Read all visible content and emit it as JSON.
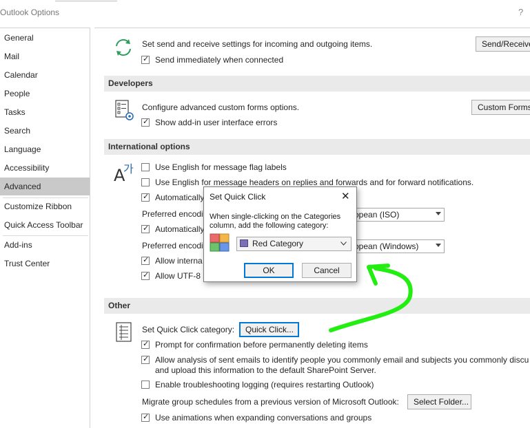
{
  "window": {
    "title": "Outlook Options",
    "help": "?"
  },
  "nav": {
    "items": [
      {
        "label": "General"
      },
      {
        "label": "Mail"
      },
      {
        "label": "Calendar"
      },
      {
        "label": "People"
      },
      {
        "label": "Tasks"
      },
      {
        "label": "Search"
      },
      {
        "label": "Language"
      },
      {
        "label": "Accessibility"
      },
      {
        "label": "Advanced",
        "active": true
      },
      {
        "label": "Customize Ribbon"
      },
      {
        "label": "Quick Access Toolbar"
      },
      {
        "label": "Add-ins"
      },
      {
        "label": "Trust Center"
      }
    ]
  },
  "send_receive": {
    "description": "Set send and receive settings for incoming and outgoing items.",
    "button": "Send/Receive...",
    "send_immediately": {
      "label": "Send immediately when connected",
      "checked": true
    }
  },
  "developers": {
    "header": "Developers",
    "description": "Configure advanced custom forms options.",
    "button": "Custom Forms...",
    "show_addin_errors": {
      "label": "Show add-in user interface errors",
      "checked": true
    }
  },
  "international": {
    "header": "International options",
    "flag_labels": {
      "label": "Use English for message flag labels",
      "checked": false
    },
    "message_headers": {
      "label": "Use English for message headers on replies and forwards and for forward notifications.",
      "checked": false
    },
    "auto1": {
      "label": "Automatically",
      "checked": true
    },
    "pref_encoding_1": {
      "label": "Preferred encodi",
      "value": "opean (ISO)"
    },
    "auto2": {
      "label": "Automatically",
      "checked": true
    },
    "pref_encoding_2": {
      "label": "Preferred encodi",
      "value": "opean (Windows)"
    },
    "allow_intl": {
      "label": "Allow interna",
      "checked": true
    },
    "allow_utf8": {
      "label": "Allow UTF-8 s",
      "checked": true
    }
  },
  "other": {
    "header": "Other",
    "quick_click_label": "Set Quick Click category:",
    "quick_click_button": "Quick Click...",
    "prompt_delete": {
      "label": "Prompt for confirmation before permanently deleting items",
      "checked": true
    },
    "allow_analysis": {
      "label": "Allow analysis of sent emails to identify people you commonly email and subjects you commonly discu",
      "line2": "and upload this information to the default SharePoint Server.",
      "checked": true
    },
    "troubleshooting": {
      "label": "Enable troubleshooting logging (requires restarting Outlook)",
      "checked": false
    },
    "migrate_label": "Migrate group schedules from a previous version of Microsoft Outlook:",
    "select_folder": "Select Folder...",
    "animations": {
      "label": "Use animations when expanding conversations and groups",
      "checked": true
    }
  },
  "dialog": {
    "title": "Set Quick Click",
    "close": "✕",
    "message_line1": "When single-clicking on the Categories",
    "message_line2": "column, add the following category:",
    "category": "Red Category",
    "ok": "OK",
    "cancel": "Cancel"
  },
  "colors": {
    "annotation_arrow": "#22ee11",
    "red_category": "#7b6fb5",
    "nav_active": "#c9c9c9"
  }
}
